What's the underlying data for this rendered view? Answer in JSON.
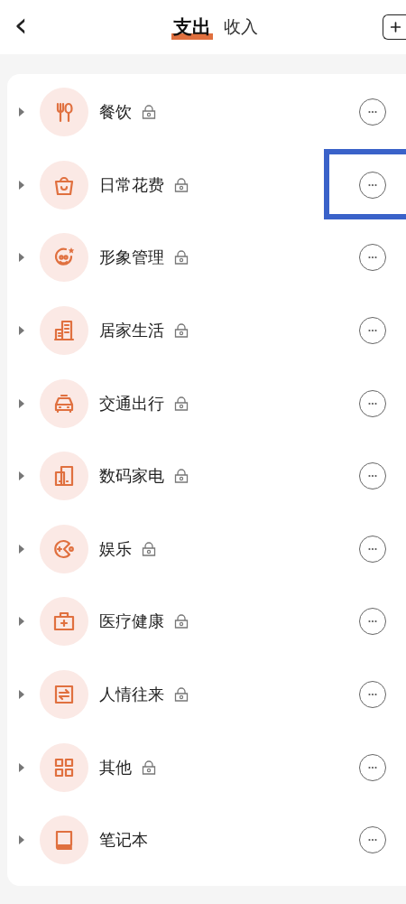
{
  "header": {
    "back": "‹",
    "tabs": [
      {
        "label": "支出",
        "selected": true
      },
      {
        "label": "收入",
        "selected": false
      }
    ]
  },
  "categories": [
    {
      "name": "餐饮",
      "locked": true,
      "highlighted": false
    },
    {
      "name": "日常花费",
      "locked": true,
      "highlighted": true
    },
    {
      "name": "形象管理",
      "locked": true,
      "highlighted": false
    },
    {
      "name": "居家生活",
      "locked": true,
      "highlighted": false
    },
    {
      "name": "交通出行",
      "locked": true,
      "highlighted": false
    },
    {
      "name": "数码家电",
      "locked": true,
      "highlighted": false
    },
    {
      "name": "娱乐",
      "locked": true,
      "highlighted": false
    },
    {
      "name": "医疗健康",
      "locked": true,
      "highlighted": false
    },
    {
      "name": "人情往来",
      "locked": true,
      "highlighted": false
    },
    {
      "name": "其他",
      "locked": true,
      "highlighted": false
    },
    {
      "name": "笔记本",
      "locked": false,
      "highlighted": false
    }
  ]
}
